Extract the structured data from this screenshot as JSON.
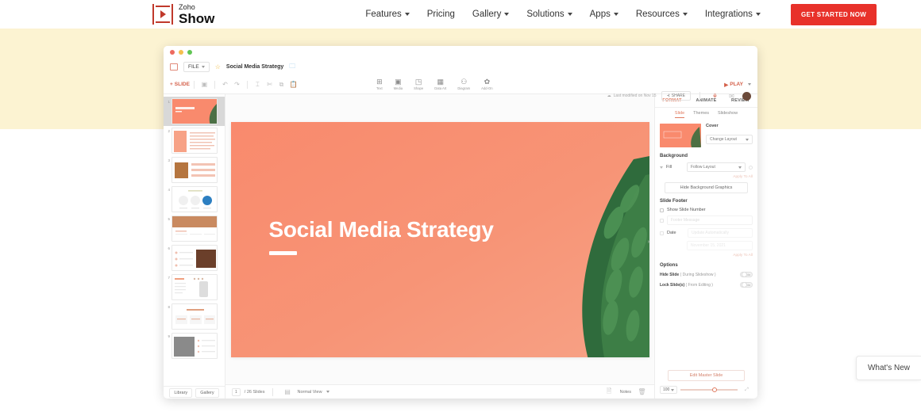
{
  "site_nav": {
    "logo": {
      "brand": "Zoho",
      "product": "Show"
    },
    "items": [
      {
        "label": "Features",
        "caret": true
      },
      {
        "label": "Pricing",
        "caret": false
      },
      {
        "label": "Gallery",
        "caret": true
      },
      {
        "label": "Solutions",
        "caret": true
      },
      {
        "label": "Apps",
        "caret": true
      },
      {
        "label": "Resources",
        "caret": true
      },
      {
        "label": "Integrations",
        "caret": true
      }
    ],
    "cta": "GET STARTED NOW"
  },
  "app": {
    "menubar": {
      "file_label": "FILE",
      "doc_title": "Social Media Strategy"
    },
    "toolbar": {
      "slide_label": "SLIDE",
      "insert_items": [
        {
          "label": "Text",
          "icon": "text-box-icon",
          "glyph": "⊞"
        },
        {
          "label": "Media",
          "icon": "media-icon",
          "glyph": "▣"
        },
        {
          "label": "Shape",
          "icon": "shape-icon",
          "glyph": "◳"
        },
        {
          "label": "Data Art",
          "icon": "data-art-icon",
          "glyph": "▦"
        },
        {
          "label": "Diagram",
          "icon": "diagram-icon",
          "glyph": "⚇"
        },
        {
          "label": "Add-On",
          "icon": "add-on-icon",
          "glyph": "✿"
        }
      ],
      "last_modified": "Last modified on Nov 15",
      "share_label": "SHARE",
      "play_label": "PLAY"
    },
    "thumbnails": {
      "slides": [
        {
          "num": "1",
          "selected": true
        },
        {
          "num": "2",
          "selected": false
        },
        {
          "num": "3",
          "selected": false
        },
        {
          "num": "4",
          "selected": false
        },
        {
          "num": "5",
          "selected": false
        },
        {
          "num": "6",
          "selected": false
        },
        {
          "num": "7",
          "selected": false
        },
        {
          "num": "8",
          "selected": false
        },
        {
          "num": "9",
          "selected": false
        }
      ],
      "footer_buttons": [
        "Library",
        "Gallery"
      ]
    },
    "slide": {
      "title": "Social Media Strategy"
    },
    "canvas_footer": {
      "page_current": "1",
      "page_total": "/ 26 Slides",
      "view_mode": "Normal View",
      "notes_label": "Notes"
    },
    "panel": {
      "tabs": [
        {
          "label": "FORMAT",
          "active": true
        },
        {
          "label": "ANIMATE",
          "active": false
        },
        {
          "label": "REVIEW",
          "active": false
        }
      ],
      "sub_tabs": [
        {
          "label": "Slide",
          "active": true
        },
        {
          "label": "Themes",
          "active": false
        },
        {
          "label": "Slideshow",
          "active": false
        }
      ],
      "cover": {
        "label": "Cover",
        "change_layout": "Change Layout"
      },
      "background": {
        "title": "Background",
        "fill_label": "Fill",
        "fill_value": "Follow Layout",
        "apply_all": "Apply To All",
        "hide_graphics": "Hide Background Graphics"
      },
      "slide_footer": {
        "title": "Slide Footer",
        "show_slide_number": "Show Slide Number",
        "footer_message_placeholder": "Footer Message",
        "date_label": "Date",
        "date_mode": "Update Automatically",
        "date_value": "November 15, 2021",
        "apply_all": "Apply To All"
      },
      "options": {
        "title": "Options",
        "hide_slide_label": "Hide Slide",
        "hide_slide_hint": "( During Slideshow )",
        "hide_slide_state": "No",
        "lock_slide_label": "Lock Slide(s)",
        "lock_slide_hint": "( From Editing )",
        "lock_slide_state": "No"
      },
      "edit_master": "Edit Master Slide",
      "zoom_value": "100"
    }
  },
  "whats_new": {
    "label": "What's New"
  },
  "colors": {
    "brand_red": "#e8312a",
    "accent_coral": "#e07a5f",
    "hero_cream": "#fcf3d2",
    "slide_coral": "#f98a6d"
  }
}
